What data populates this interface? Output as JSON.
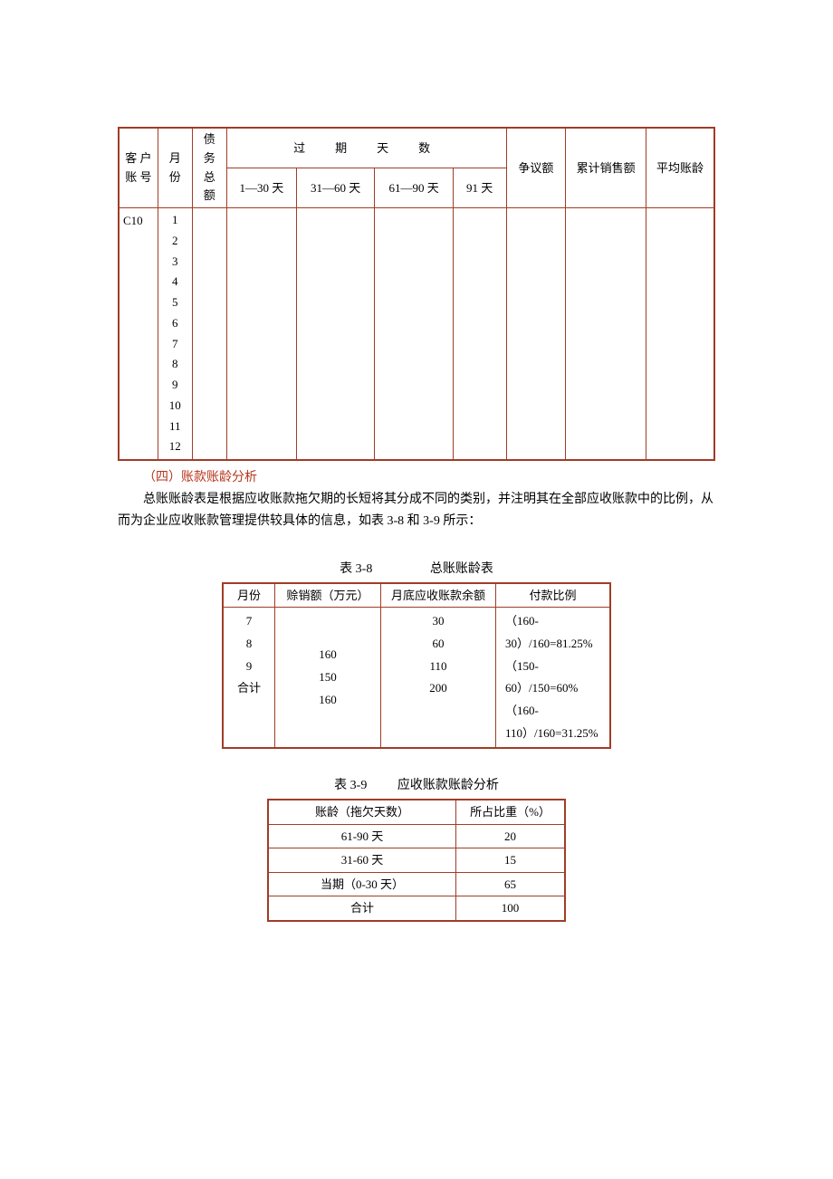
{
  "table1": {
    "headers": {
      "customer_no": "客 户 账 号",
      "month": "月 份",
      "debt_total": "债 务 总 额",
      "overdue_days": "过　期　天　数",
      "col_1_30": "1—30 天",
      "col_31_60": "31—60 天",
      "col_61_90": "61—90 天",
      "col_91": "91 天",
      "dispute": "争议额",
      "cumulative_sales": "累计销售额",
      "avg_age": "平均账龄"
    },
    "row_customer": "C10",
    "months": "1\n2\n3\n4\n5\n6\n7\n8\n9\n10\n11\n12"
  },
  "section4_title": "（四）账款账龄分析",
  "para1": "总账账龄表是根据应收账款拖欠期的长短将其分成不同的类别，并注明其在全部应收账款中的比例，从而为企业应收账款管理提供较具体的信息，如表 3-8 和 3-9 所示：",
  "table2": {
    "caption_left": "表 3-8",
    "caption_right": "总账账龄表",
    "headers": {
      "month": "月份",
      "credit_sales": "赊销额（万元）",
      "balance": "月底应收账款余额",
      "pay_ratio": "付款比例"
    },
    "months_col": "7\n8\n9\n合计",
    "credit_col": "160\n150\n160",
    "balance_col": "30\n60\n110\n200",
    "ratio_col": "（160-30）/160=81.25%\n（150-60）/150=60%\n（160-110）/160=31.25%"
  },
  "table3": {
    "caption_left": "表 3-9",
    "caption_right": "应收账款账龄分析",
    "headers": {
      "age": "账龄（拖欠天数）",
      "weight": "所占比重（%）"
    },
    "rows": [
      {
        "age": "61-90 天",
        "weight": "20"
      },
      {
        "age": "31-60 天",
        "weight": "15"
      },
      {
        "age": "当期（0-30 天）",
        "weight": "65"
      },
      {
        "age": "合计",
        "weight": "100"
      }
    ]
  }
}
